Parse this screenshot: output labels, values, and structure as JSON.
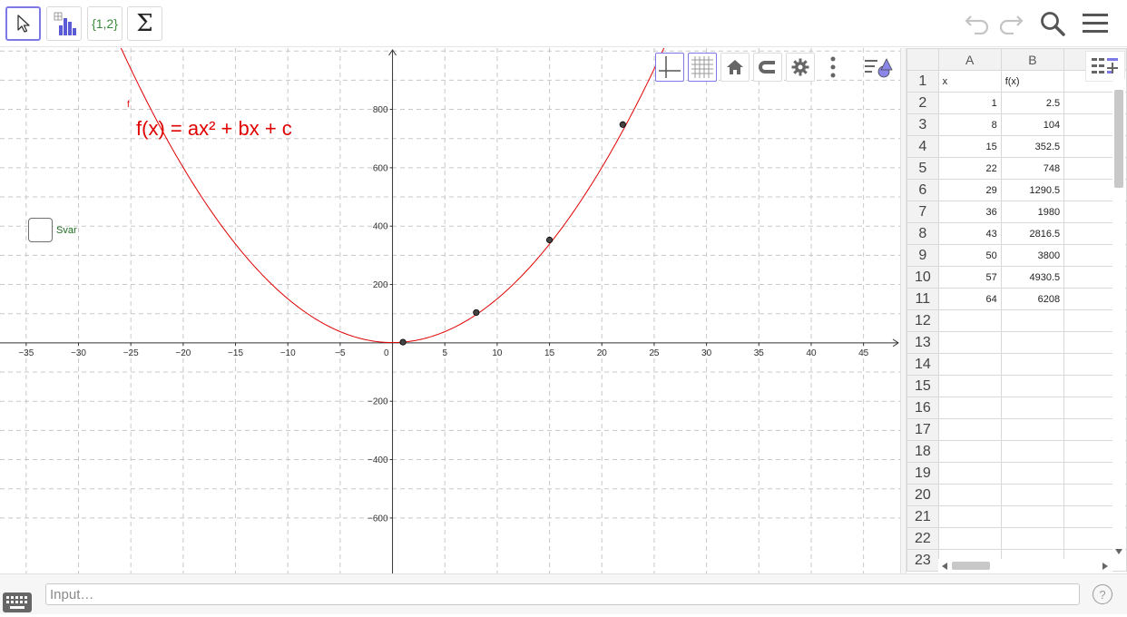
{
  "toolbar": {
    "tools": [
      {
        "name": "move",
        "icon": "cursor-arrow-icon",
        "selected": true
      },
      {
        "name": "two-variable-regression-analysis",
        "icon": "bar-chart-icon"
      },
      {
        "name": "create-list",
        "icon": "list-braces-icon",
        "label": "{1,2}"
      },
      {
        "name": "sum",
        "icon": "sigma-icon",
        "label": "Σ"
      }
    ],
    "right_icons": [
      "undo-icon",
      "redo-icon",
      "search-icon",
      "hamburger-menu-icon"
    ]
  },
  "graphics": {
    "formula": "f(x) = ax² + bx + c",
    "curve_label": "f",
    "checkbox": {
      "label": "Svar",
      "checked": false
    },
    "style_bar": [
      "axes-icon",
      "grid-icon",
      "home-icon",
      "magnet-icon",
      "gear-icon",
      "more-vertical-icon"
    ],
    "style_bar_selected": [
      "axes-icon",
      "grid-icon"
    ],
    "style_bar_toggle": "style-bar-toggle-icon",
    "colors": {
      "curve": "#e00000",
      "points": "#444444",
      "grid": "#c8c8c8",
      "formula": "#e00000",
      "checkbox_label": "#1a6b1a"
    }
  },
  "chart_data": {
    "type": "line",
    "title": "",
    "xlabel": "",
    "ylabel": "",
    "xlim": [
      -37.5,
      48.5
    ],
    "ylim": [
      -790,
      1010
    ],
    "x_ticks": [
      -35,
      -30,
      -25,
      -20,
      -15,
      -10,
      -5,
      0,
      5,
      10,
      15,
      20,
      25,
      30,
      35,
      40,
      45
    ],
    "y_ticks": [
      -600,
      -400,
      -200,
      200,
      400,
      600,
      800
    ],
    "grid": true,
    "series": [
      {
        "kind": "curve",
        "function": {
          "a": 1.5,
          "b": 0,
          "c": 1
        }
      },
      {
        "kind": "points",
        "x": [
          1,
          8,
          15,
          22
        ],
        "y": [
          2.5,
          104,
          352.5,
          748
        ]
      }
    ]
  },
  "spreadsheet": {
    "columns": [
      "A",
      "B",
      ""
    ],
    "rows": [
      [
        "x",
        "f(x)"
      ],
      [
        "1",
        "2.5"
      ],
      [
        "8",
        "104"
      ],
      [
        "15",
        "352.5"
      ],
      [
        "22",
        "748"
      ],
      [
        "29",
        "1290.5"
      ],
      [
        "36",
        "1980"
      ],
      [
        "43",
        "2816.5"
      ],
      [
        "50",
        "3800"
      ],
      [
        "57",
        "4930.5"
      ],
      [
        "64",
        "6208"
      ],
      [
        "",
        ""
      ],
      [
        "",
        ""
      ],
      [
        "",
        ""
      ],
      [
        "",
        ""
      ],
      [
        "",
        ""
      ],
      [
        "",
        ""
      ],
      [
        "",
        ""
      ],
      [
        "",
        ""
      ],
      [
        "",
        ""
      ],
      [
        "",
        ""
      ],
      [
        "",
        ""
      ],
      [
        "",
        ""
      ]
    ],
    "menu_icon": "spreadsheet-menu-icon"
  },
  "input_bar": {
    "placeholder": "Input…",
    "keyboard_icon": "keyboard-icon",
    "help_label": "?"
  }
}
